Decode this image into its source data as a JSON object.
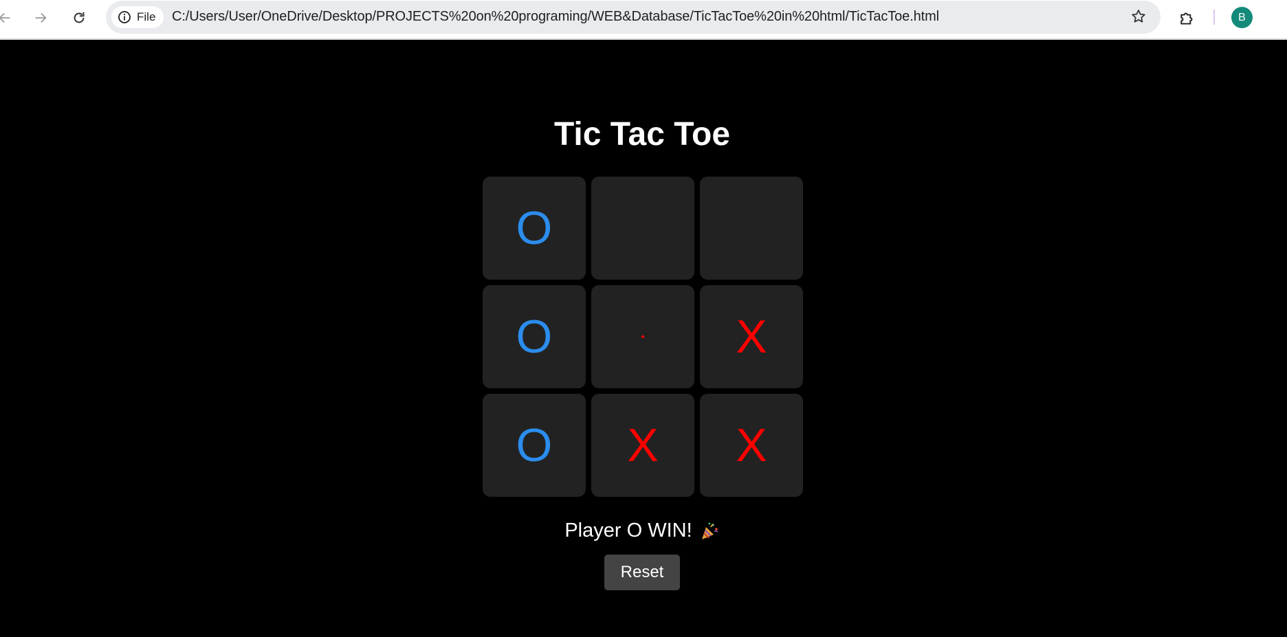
{
  "browser": {
    "site_chip_label": "File",
    "url": "C:/Users/User/OneDrive/Desktop/PROJECTS%20on%20programing/WEB&Database/TicTacToe%20in%20html/TicTacToe.html",
    "profile_initial": "B",
    "icons": {
      "back": "arrow-left-icon",
      "forward": "arrow-right-icon",
      "reload": "reload-icon",
      "site_info": "info-icon",
      "bookmark": "star-icon",
      "extensions": "puzzle-icon"
    },
    "colors": {
      "address_bar": "#e9ebee",
      "avatar": "#138a7a"
    }
  },
  "game": {
    "title": "Tic Tac Toe",
    "board": [
      [
        "O",
        "",
        ""
      ],
      [
        "O",
        "",
        "X"
      ],
      [
        "O",
        "X",
        "X"
      ]
    ],
    "status_text": "Player O WIN!",
    "status_icon": "party-popper-icon",
    "reset_label": "Reset",
    "colors": {
      "background": "#000000",
      "cell": "#222222",
      "o_mark": "#2b8ded",
      "x_mark": "#ff0000",
      "reset_button": "#444444"
    }
  }
}
